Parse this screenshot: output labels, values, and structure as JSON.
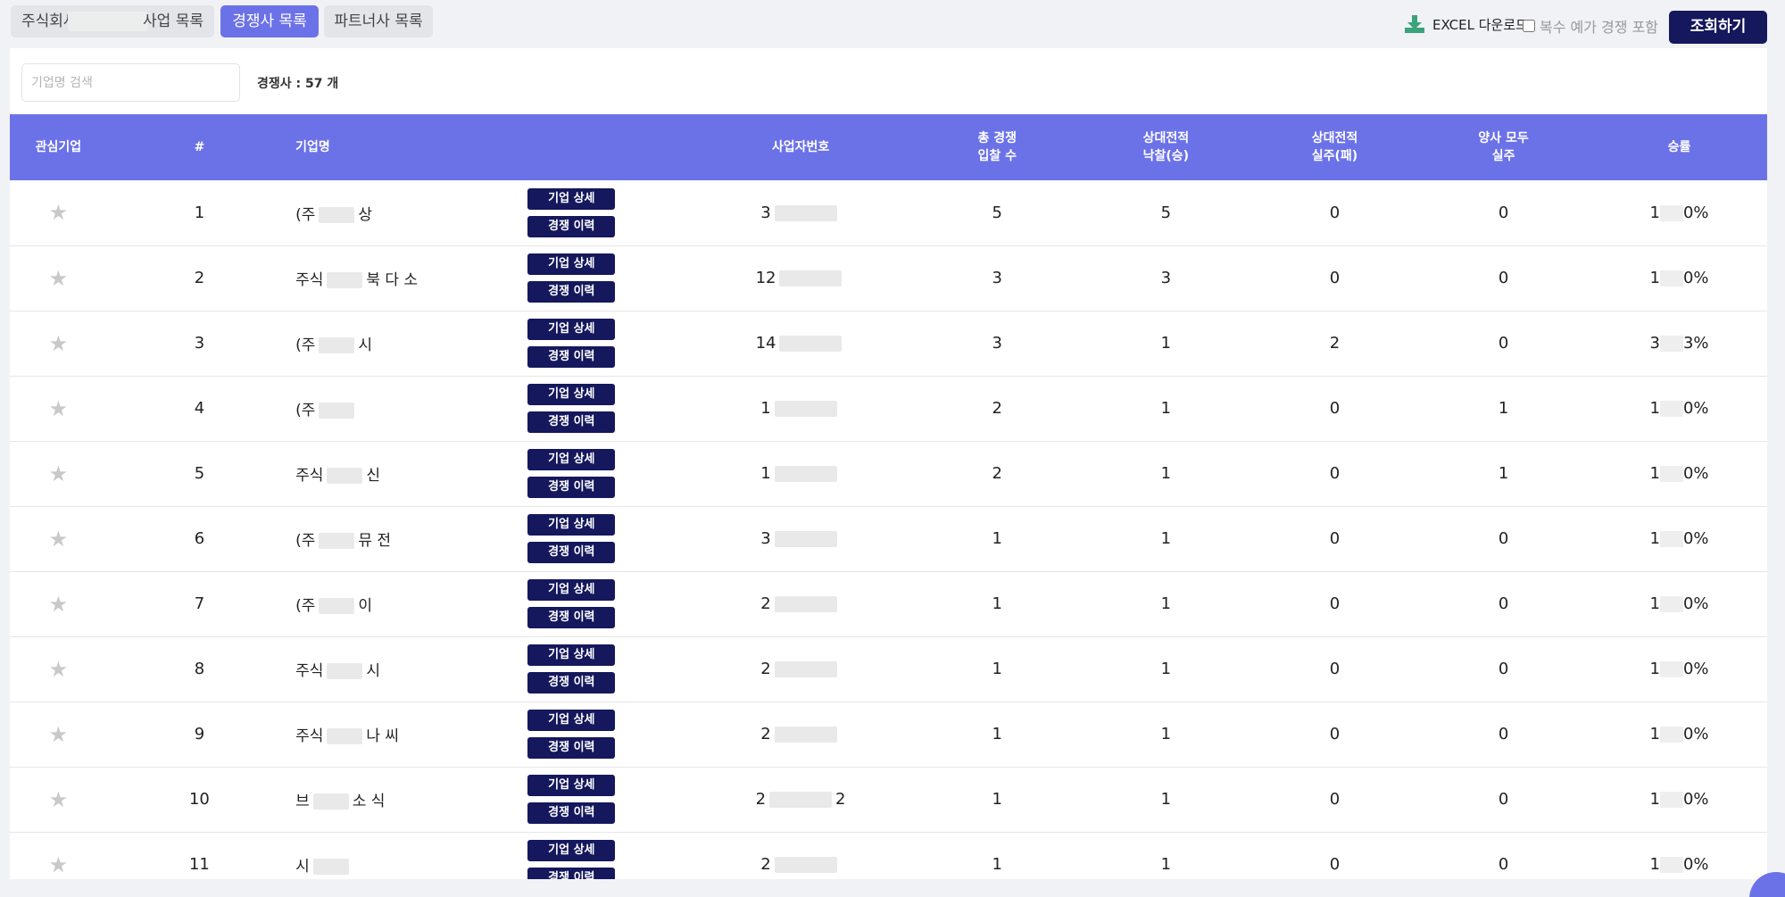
{
  "tabs": {
    "company_prefix": "주식회사",
    "company_suffix": "사업 목록",
    "competitors": "경쟁사 목록",
    "partners": "파트너사 목록"
  },
  "toolbar": {
    "excel": "EXCEL 다운로드",
    "multi_checkbox": "복수 예가 경쟁 포함",
    "search_button": "조회하기"
  },
  "panel": {
    "search_placeholder": "기업명 검색",
    "count_label": "경쟁사 : 57 개"
  },
  "table": {
    "headers": {
      "favorite": "관심기업",
      "index": "#",
      "name": "기업명",
      "biz_no": "사업자번호",
      "total_l1": "총 경쟁",
      "total_l2": "입찰 수",
      "win_l1": "상대전적",
      "win_l2": "낙찰(승)",
      "loss_l1": "상대전적",
      "loss_l2": "실주(패)",
      "both_l1": "양사 모두",
      "both_l2": "실주",
      "rate": "승률"
    },
    "detail_label": "기업 상세",
    "history_label": "경쟁 이력",
    "rows": [
      {
        "no": "1",
        "name_a": "(주",
        "name_b": "상",
        "biz_a": "3",
        "biz_b": "",
        "total": "5",
        "win": "5",
        "loss": "0",
        "both": "0",
        "rate_a": "1",
        "rate_b": "0%"
      },
      {
        "no": "2",
        "name_a": "주식",
        "name_b": "북  다  소",
        "biz_a": "12",
        "biz_b": "",
        "total": "3",
        "win": "3",
        "loss": "0",
        "both": "0",
        "rate_a": "1",
        "rate_b": "0%"
      },
      {
        "no": "3",
        "name_a": "(주",
        "name_b": "시",
        "biz_a": "14",
        "biz_b": "",
        "total": "3",
        "win": "1",
        "loss": "2",
        "both": "0",
        "rate_a": "3",
        "rate_b": "3%"
      },
      {
        "no": "4",
        "name_a": "(주",
        "name_b": "",
        "biz_a": "1",
        "biz_b": "",
        "total": "2",
        "win": "1",
        "loss": "0",
        "both": "1",
        "rate_a": "1",
        "rate_b": "0%"
      },
      {
        "no": "5",
        "name_a": "주식",
        "name_b": "신",
        "biz_a": "1",
        "biz_b": "",
        "total": "2",
        "win": "1",
        "loss": "0",
        "both": "1",
        "rate_a": "1",
        "rate_b": "0%"
      },
      {
        "no": "6",
        "name_a": "(주",
        "name_b": "뮤  전",
        "biz_a": "3",
        "biz_b": "",
        "total": "1",
        "win": "1",
        "loss": "0",
        "both": "0",
        "rate_a": "1",
        "rate_b": "0%"
      },
      {
        "no": "7",
        "name_a": "(주",
        "name_b": "이",
        "biz_a": "2",
        "biz_b": "",
        "total": "1",
        "win": "1",
        "loss": "0",
        "both": "0",
        "rate_a": "1",
        "rate_b": "0%"
      },
      {
        "no": "8",
        "name_a": "주식",
        "name_b": "시",
        "biz_a": "2",
        "biz_b": "",
        "total": "1",
        "win": "1",
        "loss": "0",
        "both": "0",
        "rate_a": "1",
        "rate_b": "0%"
      },
      {
        "no": "9",
        "name_a": "주식",
        "name_b": "나  씨",
        "biz_a": "2",
        "biz_b": "",
        "total": "1",
        "win": "1",
        "loss": "0",
        "both": "0",
        "rate_a": "1",
        "rate_b": "0%"
      },
      {
        "no": "10",
        "name_a": "브",
        "name_b": "소  식",
        "biz_a": "2",
        "biz_b": "2",
        "total": "1",
        "win": "1",
        "loss": "0",
        "both": "0",
        "rate_a": "1",
        "rate_b": "0%"
      },
      {
        "no": "11",
        "name_a": "시",
        "name_b": "",
        "biz_a": "2",
        "biz_b": "",
        "total": "1",
        "win": "1",
        "loss": "0",
        "both": "0",
        "rate_a": "1",
        "rate_b": "0%"
      }
    ]
  },
  "colors": {
    "accent": "#6b72e8",
    "navy": "#15185c",
    "excel_green": "#3aa37a"
  }
}
